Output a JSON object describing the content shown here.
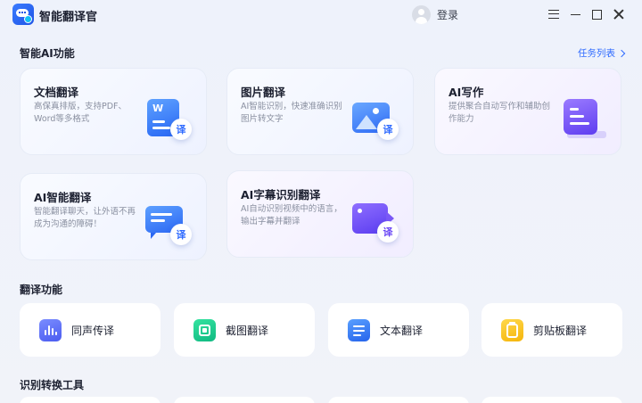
{
  "app": {
    "title": "智能翻译官"
  },
  "header": {
    "login_label": "登录"
  },
  "ai_section": {
    "title": "智能AI功能",
    "task_link": "任务列表",
    "cards": [
      {
        "title": "文档翻译",
        "desc": "高保真排版，支持PDF、Word等多格式",
        "badge": "译",
        "icon": "word-document-icon"
      },
      {
        "title": "图片翻译",
        "desc": "AI智能识别，快速准确识别图片转文字",
        "badge": "译",
        "icon": "image-icon"
      },
      {
        "title": "AI写作",
        "desc": "提供聚合自动写作和辅助创作能力",
        "icon": "writing-icon"
      },
      {
        "title": "AI智能翻译",
        "desc": "智能翻译聊天，让外语不再成为沟通的障碍！",
        "badge": "译",
        "icon": "chat-bubble-icon"
      },
      {
        "title": "AI字幕识别翻译",
        "desc": "AI自动识别视频中的语言，输出字幕并翻译",
        "badge": "译",
        "icon": "video-camera-icon"
      }
    ]
  },
  "translate_section": {
    "title": "翻译功能",
    "items": [
      {
        "label": "同声传译",
        "icon": "sound-wave-icon"
      },
      {
        "label": "截图翻译",
        "icon": "screenshot-icon"
      },
      {
        "label": "文本翻译",
        "icon": "text-list-icon"
      },
      {
        "label": "剪贴板翻译",
        "icon": "clipboard-icon"
      }
    ]
  },
  "convert_section": {
    "title": "识别转换工具"
  },
  "colors": {
    "accent": "#2f6bff",
    "violet": "#6a47f5",
    "green": "#10b981",
    "yellow": "#f5b50c"
  }
}
